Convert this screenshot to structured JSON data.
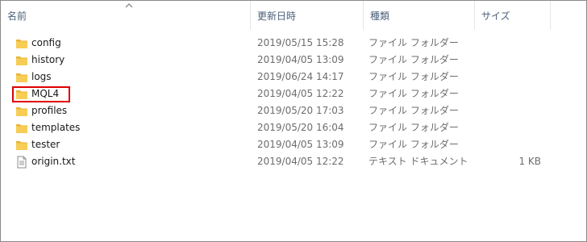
{
  "columns": {
    "name": "名前",
    "date": "更新日時",
    "type": "種類",
    "size": "サイズ"
  },
  "files": [
    {
      "name": "config",
      "date": "2019/05/15 15:28",
      "type": "ファイル フォルダー",
      "size": "",
      "icon": "folder-icon"
    },
    {
      "name": "history",
      "date": "2019/04/05 13:09",
      "type": "ファイル フォルダー",
      "size": "",
      "icon": "folder-icon"
    },
    {
      "name": "logs",
      "date": "2019/06/24 14:17",
      "type": "ファイル フォルダー",
      "size": "",
      "icon": "folder-icon"
    },
    {
      "name": "MQL4",
      "date": "2019/04/05 12:22",
      "type": "ファイル フォルダー",
      "size": "",
      "icon": "folder-icon",
      "highlighted": true
    },
    {
      "name": "profiles",
      "date": "2019/05/20 17:03",
      "type": "ファイル フォルダー",
      "size": "",
      "icon": "folder-icon"
    },
    {
      "name": "templates",
      "date": "2019/05/20 16:04",
      "type": "ファイル フォルダー",
      "size": "",
      "icon": "folder-icon"
    },
    {
      "name": "tester",
      "date": "2019/04/05 13:09",
      "type": "ファイル フォルダー",
      "size": "",
      "icon": "folder-icon"
    },
    {
      "name": "origin.txt",
      "date": "2019/04/05 12:22",
      "type": "テキスト ドキュメント",
      "size": "1 KB",
      "icon": "text-file-icon"
    }
  ],
  "colors": {
    "header_text": "#4c607a",
    "folder": "#f4c542",
    "highlight": "#e00000"
  }
}
